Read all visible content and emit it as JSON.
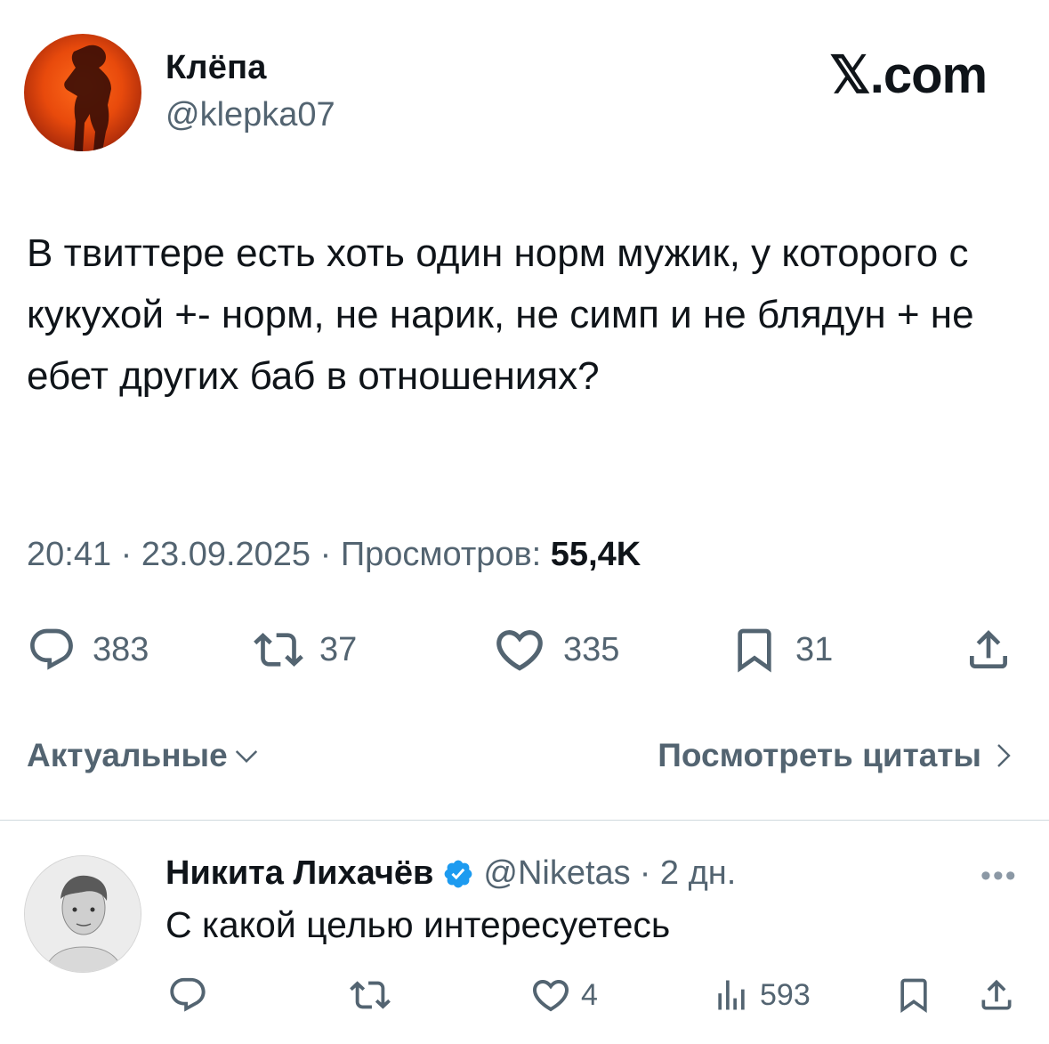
{
  "tweet": {
    "author_name": "Клёпа",
    "author_handle": "@klepka07",
    "brand": "𝕏.com",
    "text": "В твиттере есть хоть один норм мужик, у которого с кукухой +- норм, не нарик, не симп и не блядун + не ебет других баб в отношениях?",
    "timestamp": "20:41 · 23.09.2025 · Просмотров: ",
    "views": "55,4K",
    "actions": {
      "replies": "383",
      "reposts": "37",
      "likes": "335",
      "bookmarks": "31"
    }
  },
  "sort": {
    "label": "Актуальные"
  },
  "quotes": {
    "label": "Посмотреть цитаты"
  },
  "reply": {
    "author_name": "Никита Лихачёв",
    "author_handle": "@Niketas",
    "time": "· 2 дн.",
    "text": "С какой целью интересуетесь",
    "actions": {
      "likes": "4",
      "views": "593"
    }
  },
  "colors": {
    "text": "#0f1419",
    "secondary": "#536471",
    "verified": "#1d9bf0",
    "divider": "#cfd9de"
  }
}
